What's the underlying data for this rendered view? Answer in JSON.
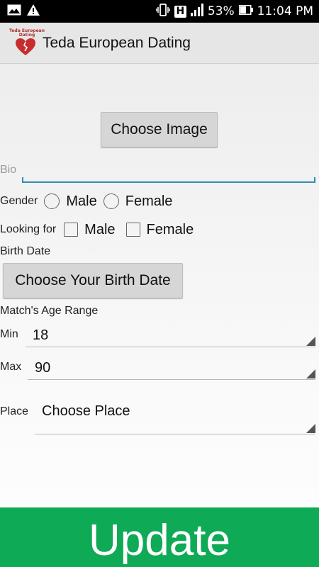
{
  "status_bar": {
    "battery": "53%",
    "time": "11:04 PM",
    "network_badge": "H",
    "icons": [
      "image-notification-icon",
      "warning-icon",
      "vibrate-icon",
      "network-h-icon",
      "signal-icon",
      "battery-icon"
    ]
  },
  "action_bar": {
    "logo_text": "Teda European Dating",
    "title": "Teda European Dating"
  },
  "form": {
    "choose_image_label": "Choose Image",
    "bio_label": "Bio",
    "bio_value": "",
    "gender_label": "Gender",
    "gender_options": [
      "Male",
      "Female"
    ],
    "looking_for_label": "Looking for",
    "looking_for_options": [
      "Male",
      "Female"
    ],
    "birth_date_label": "Birth Date",
    "birth_date_button": "Choose Your Birth Date",
    "age_range_label": "Match's Age Range",
    "min_label": "Min",
    "min_value": "18",
    "max_label": "Max",
    "max_value": "90",
    "place_label": "Place",
    "place_value": "Choose Place"
  },
  "update_button": "Update",
  "colors": {
    "accent_green": "#0faa56",
    "input_underline": "#2e8fb0",
    "logo_red": "#c62d2d"
  }
}
